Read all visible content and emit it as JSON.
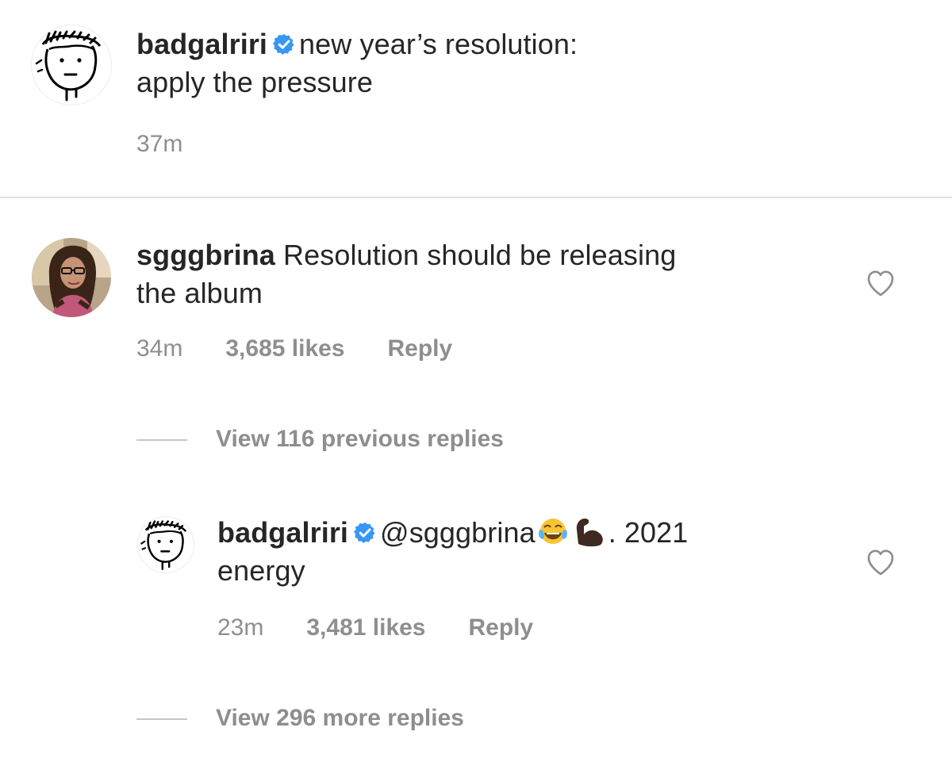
{
  "caption": {
    "username": "badgalriri",
    "verified": true,
    "text_line1": "new year’s resolution:",
    "text_line2": "apply the pressure",
    "time": "37m"
  },
  "comments": [
    {
      "username": "sgggbrina",
      "verified": false,
      "text_line1": "Resolution should be releasing",
      "text_line2": "the album",
      "time": "34m",
      "likes": "3,685 likes",
      "reply_label": "Reply",
      "view_replies": "View 116 previous replies"
    }
  ],
  "reply": {
    "username": "badgalriri",
    "verified": true,
    "mention": "@sgggbrina",
    "emojis": [
      "face-with-tears-of-joy-icon",
      "flexed-biceps-icon"
    ],
    "text_after_emoji": ". 2021",
    "text_line2": "energy",
    "time": "23m",
    "likes": "3,481 likes",
    "reply_label": "Reply",
    "view_replies": "View 296 more replies"
  },
  "colors": {
    "text": "#262626",
    "secondary": "#8e8e8e",
    "verified_blue": "#3897f0",
    "divider": "#e3e3e3"
  }
}
